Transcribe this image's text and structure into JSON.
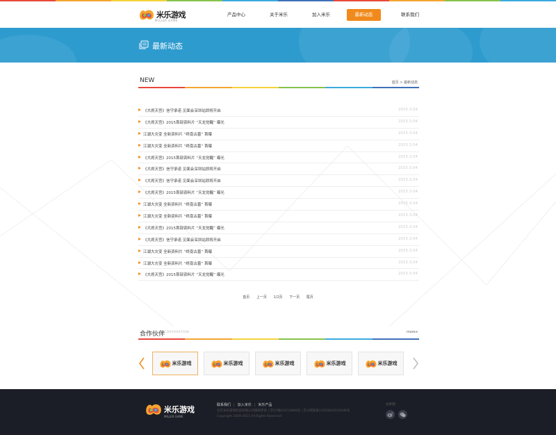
{
  "colors": {
    "accent": "#f08a1c",
    "banner": "#2e9bcf",
    "footer": "#1c1e27",
    "rainbow": [
      "#e8473c",
      "#f4a530",
      "#f5d23b",
      "#86c24a",
      "#3aa9df",
      "#3d6fb8",
      "#e8473c",
      "#f4a530",
      "#86c24a",
      "#3aa9df"
    ]
  },
  "header": {
    "logo_text": "米乐游戏",
    "logo_sub": "MILLER GAME",
    "nav": [
      {
        "label": "产品中心"
      },
      {
        "label": "关于米乐"
      },
      {
        "label": "加入米乐"
      },
      {
        "label": "最新动态",
        "active": true
      },
      {
        "label": "联系我们"
      }
    ]
  },
  "banner": {
    "title": "最新动态",
    "icon": "news-icon"
  },
  "news": {
    "title": "NEW",
    "breadcrumb_home": "首页",
    "breadcrumb_sep": ">",
    "breadcrumb_current": "最新动态",
    "items": [
      {
        "title": "《大闹天宫》信守承诺 见面会深圳站即将开启",
        "date": "2015.3.04"
      },
      {
        "title": "《大闹天宫》2015首部资料片 “天龙觉醒” 曝光",
        "date": "2015.3.04"
      },
      {
        "title": "江湖大灾变 全新资料片 “终南古墓” 首曝",
        "date": "2015.3.04"
      },
      {
        "title": "江湖大灾变 全新资料片 “终南古墓” 首曝",
        "date": "2015.3.04"
      },
      {
        "title": "《大闹天宫》2015首部资料片 “天龙觉醒” 曝光",
        "date": "2015.3.04"
      },
      {
        "title": "《大闹天宫》信守承诺 见面会深圳站即将开启",
        "date": "2015.3.04"
      },
      {
        "title": "《大闹天宫》信守承诺 见面会深圳站即将开启",
        "date": "2015.3.04"
      },
      {
        "title": "《大闹天宫》2015首部资料片 “天龙觉醒” 曝光",
        "date": "2015.3.04"
      },
      {
        "title": "江湖大灾变 全新资料片 “终南古墓” 首曝",
        "date": "2015.3.04"
      },
      {
        "title": "江湖大灾变 全新资料片 “终南古墓” 首曝",
        "date": "2015.3.04"
      },
      {
        "title": "《大闹天宫》2015首部资料片 “天龙觉醒” 曝光",
        "date": "2015.3.04"
      },
      {
        "title": "《大闹天宫》信守承诺 见面会深圳站即将开启",
        "date": "2015.3.04"
      },
      {
        "title": "江湖大灾变 全新资料片 “终南古墓” 首曝",
        "date": "2015.3.04"
      },
      {
        "title": "江湖大灾变 全新资料片 “终南古墓” 首曝",
        "date": "2015.3.04"
      },
      {
        "title": "《大闹天宫》2015首部资料片 “天龙觉醒” 曝光",
        "date": "2015.3.04"
      }
    ]
  },
  "pager": {
    "first": "首页",
    "prev": "上一页",
    "current": "1/2页",
    "next": "下一页",
    "last": "尾页"
  },
  "partners": {
    "title": "合作伙伴",
    "subtitle": "CORPORATION",
    "more": "more+",
    "logo_text": "米乐游戏",
    "count": 5,
    "active_index": 0
  },
  "footer": {
    "logo_text": "米乐游戏",
    "logo_sub": "MILLER GAME",
    "links": [
      "联系我们",
      "加入米乐",
      "米乐产品"
    ],
    "info_line1": "北京米乐游戏科技有限公司版权所有 | 京ICP备10210880号 | 京公网安备11010802016446号",
    "info_line2": "Copyright 2009-2015 All Rights Reserved",
    "share_label": "分享到：",
    "share_icons": [
      "weibo-icon",
      "wechat-icon"
    ]
  }
}
